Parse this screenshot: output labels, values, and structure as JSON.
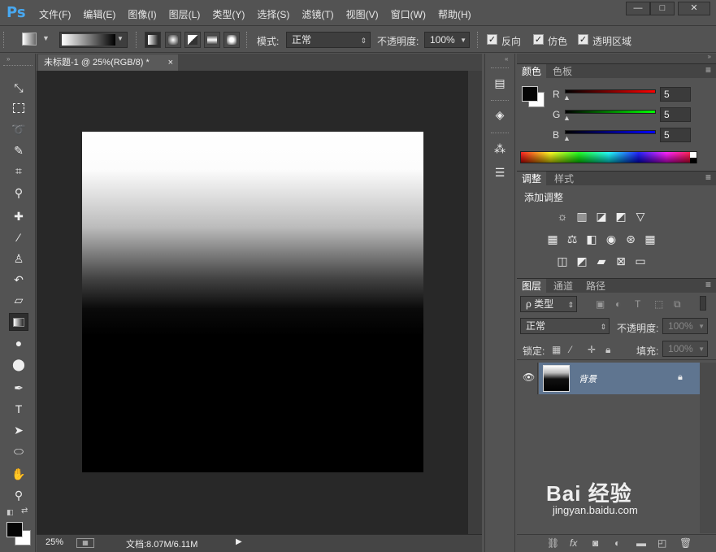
{
  "app": {
    "logo": "Ps"
  },
  "menu": [
    "文件(F)",
    "编辑(E)",
    "图像(I)",
    "图层(L)",
    "类型(Y)",
    "选择(S)",
    "滤镜(T)",
    "视图(V)",
    "窗口(W)",
    "帮助(H)"
  ],
  "window_controls": {
    "minimize": "—",
    "maximize": "□",
    "close": "✕"
  },
  "options": {
    "mode_label": "模式:",
    "mode_value": "正常",
    "opacity_label": "不透明度:",
    "opacity_value": "100%",
    "reverse_label": "反向",
    "dither_label": "仿色",
    "transparency_label": "透明区域"
  },
  "document": {
    "tab_title": "未标题-1 @ 25%(RGB/8) *",
    "close": "×",
    "zoom": "25%",
    "doc_info": "文档:8.07M/6.11M"
  },
  "color_panel": {
    "tabs": [
      "颜色",
      "色板"
    ],
    "r_label": "R",
    "g_label": "G",
    "b_label": "B",
    "r_value": "5",
    "g_value": "5",
    "b_value": "5"
  },
  "adjust_panel": {
    "tabs": [
      "调整",
      "样式"
    ],
    "title": "添加调整"
  },
  "layers_panel": {
    "tabs": [
      "图层",
      "通道",
      "路径"
    ],
    "filter_label": "ρ 类型",
    "blend_mode": "正常",
    "opacity_label": "不透明度:",
    "opacity_value": "100%",
    "lock_label": "锁定:",
    "fill_label": "填充:",
    "fill_value": "100%",
    "layer_name": "背景"
  },
  "colors": {
    "accent": "#48a8f0",
    "layer_selected": "#5f7590"
  },
  "watermark": {
    "brand": "Bai 经验",
    "url": "jingyan.baidu.com"
  }
}
